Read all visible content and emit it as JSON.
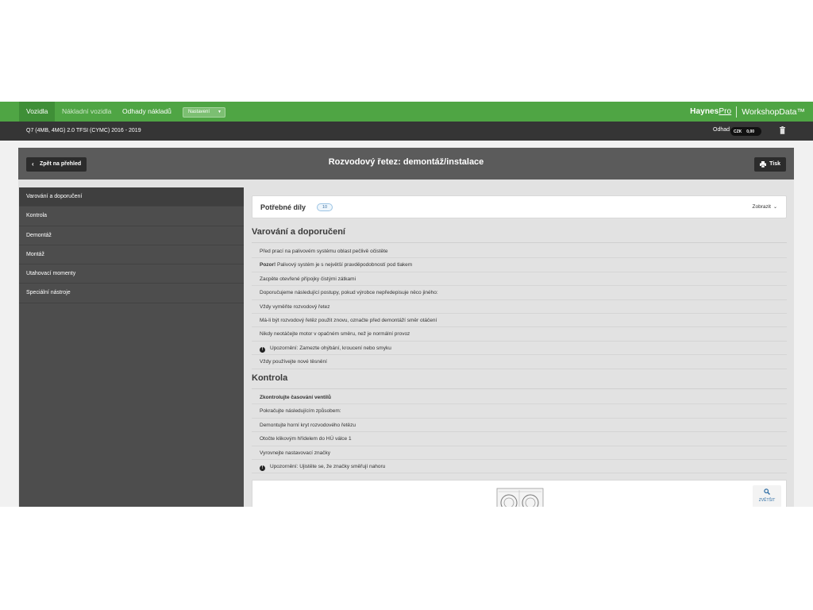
{
  "topbar": {
    "tabs": [
      {
        "label": "Vozidla"
      },
      {
        "label": "Nákladní vozidla"
      },
      {
        "label": "Odhady nákladů"
      }
    ],
    "select_label": "Nastavení",
    "brand_haynes": "Haynes",
    "brand_pro": "Pro",
    "brand_product": "WorkshopData™"
  },
  "vehicle_bar": {
    "vehicle": "Q7 (4MB, 4MG) 2.0 TFSI (CYMC) 2016 - 2019",
    "estimate_label": "Odhad",
    "currency": "CZK",
    "amount": "0,00"
  },
  "header": {
    "back_label": "Zpět na přehled",
    "title": "Rozvodový řetez: demontáž/instalace",
    "print_label": "Tisk"
  },
  "sidebar": {
    "items": [
      {
        "label": "Varování a doporučení"
      },
      {
        "label": "Kontrola"
      },
      {
        "label": "Demontáž"
      },
      {
        "label": "Montáž"
      },
      {
        "label": "Utahovací momenty"
      },
      {
        "label": "Speciální nástroje"
      }
    ]
  },
  "parts": {
    "label": "Potřebné díly",
    "count": "10",
    "show_label": "Zobrazit"
  },
  "warnings_section": {
    "title": "Varování a doporučení",
    "rows": [
      {
        "text": "Před prací na palivovém systému oblast pečlivě očistěte"
      },
      {
        "bold": "Pozor!",
        "text": " Palivový systém je s největší pravděpodobností pod tlakem"
      },
      {
        "text": "Zacpěte otevřené přípojky čistými zátkami"
      },
      {
        "text": "Doporučujeme následující postupy, pokud výrobce nepředepisuje něco jiného:"
      },
      {
        "text": "Vždy vyměňte rozvodový řetez"
      },
      {
        "text": "Má-li být rozvodový řetěz použit znovu, označte před demontáží směr otáčení"
      },
      {
        "text": "Nikdy neotáčejte motor v opačném směru, než je normální provoz"
      },
      {
        "text": "Upozornění: Zamezte ohýbání, kroucení nebo smyku"
      },
      {
        "text": "Vždy používejte nové těsnění"
      }
    ]
  },
  "check_section": {
    "title": "Kontrola",
    "rows": [
      {
        "text": "Zkontrolujte časování ventilů"
      },
      {
        "text": "Pokračujte následujícím způsobem:"
      },
      {
        "text": "Demontujte horní kryt rozvodového řetězu"
      },
      {
        "text": "Otočte klikovým hřídelem do HÚ válce 1"
      },
      {
        "text": "Vyrovnejte nastavovací značky"
      },
      {
        "text": "Upozornění: Ujistěte se, že značky směřují nahoru"
      }
    ]
  },
  "figure": {
    "zoom_label": "ZVĚTŠIT"
  },
  "colors": {
    "topbar": "#4fa544",
    "vehicle_bar": "#353535",
    "header_bar": "#5b5b5b",
    "sidebar": "#4d4d4d"
  }
}
